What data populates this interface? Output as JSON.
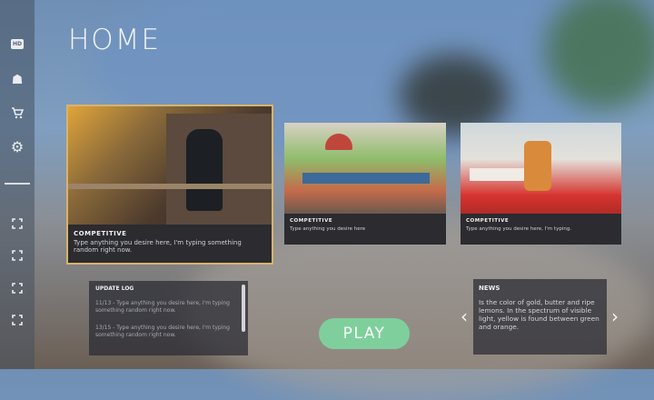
{
  "page": {
    "title": "HOME"
  },
  "sidebar": {
    "items": [
      {
        "name": "hd-icon",
        "glyph": "HD"
      },
      {
        "name": "avatar-icon",
        "glyph": "☗"
      },
      {
        "name": "shop-cart-icon",
        "glyph": "🛒"
      },
      {
        "name": "settings-gear-icon",
        "glyph": "⚙"
      },
      {
        "name": "expand-icon-1",
        "glyph": "⛶"
      },
      {
        "name": "expand-icon-2",
        "glyph": "⛶"
      },
      {
        "name": "expand-icon-3",
        "glyph": "⛶"
      },
      {
        "name": "expand-icon-4",
        "glyph": "⛶"
      }
    ]
  },
  "cards": [
    {
      "tag": "COMPETITIVE",
      "desc": "Type anything you desire here, I'm typing something random right now."
    },
    {
      "tag": "COMPETITIVE",
      "desc": "Type anything you desire here"
    },
    {
      "tag": "COMPETITIVE",
      "desc": "Type anything you desire here, I'm typing."
    }
  ],
  "update_log": {
    "title": "UPDATE LOG",
    "entries": [
      "11/13 - Type anything you desire here, I'm typing something random right now.",
      "13/15 - Type anything you desire here, I'm typing something random right now."
    ]
  },
  "news": {
    "title": "NEWS",
    "body": "Is the color of gold, butter and ripe lemons. In the spectrum of visible light, yellow is found between green and orange."
  },
  "play": {
    "label": "PLAY"
  },
  "colors": {
    "accent": "#7fcf9c",
    "featured_border": "#d9b36a"
  }
}
